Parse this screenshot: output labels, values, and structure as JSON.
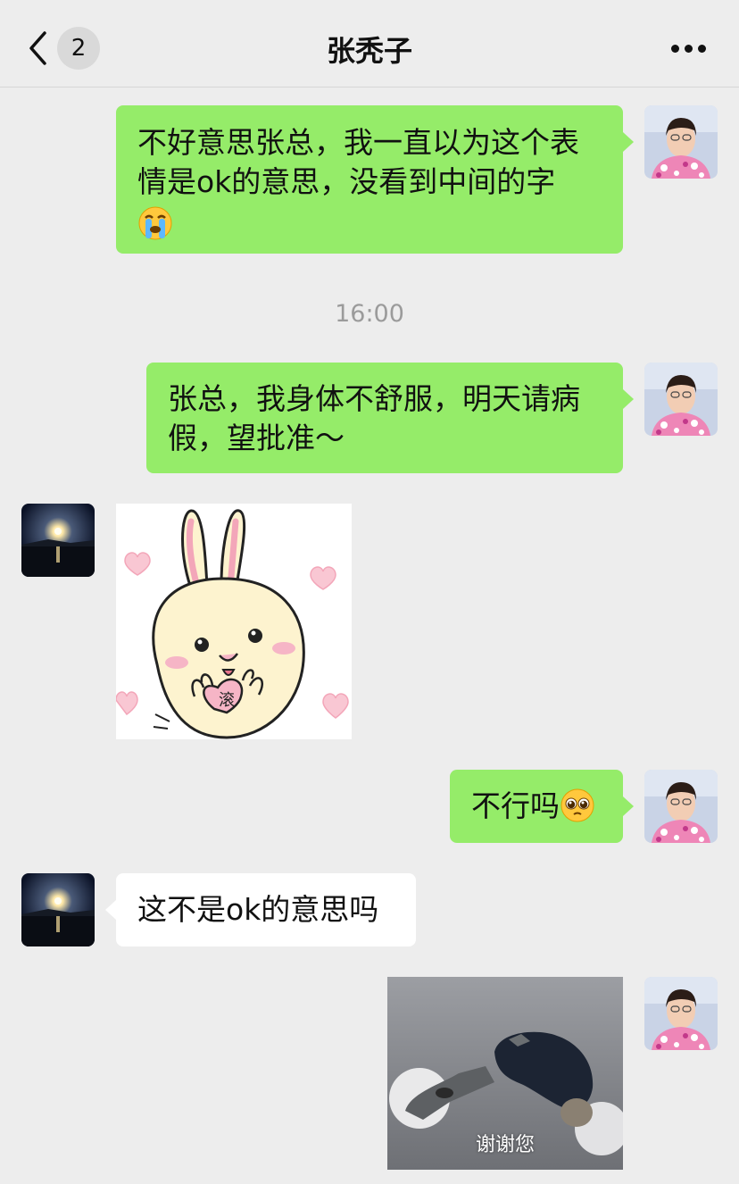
{
  "header": {
    "back_icon": "chevron-left-icon",
    "unread_count": "2",
    "title": "张秃子",
    "more_icon": "ellipsis-icon"
  },
  "messages": [
    {
      "side": "right",
      "type": "text",
      "lines": [
        "不好意思张总，我一直以为这个表",
        "情是ok的意思，没看到中间的字"
      ],
      "emoji": "crying-emoji-icon"
    },
    {
      "type": "timestamp",
      "text": "16:00"
    },
    {
      "side": "right",
      "type": "text",
      "lines": [
        "张总，我身体不舒服，明天请病",
        "假，望批准～"
      ]
    },
    {
      "side": "left",
      "type": "sticker",
      "sticker_text": "滚",
      "icon": "bunny-heart-sticker"
    },
    {
      "side": "right",
      "type": "text",
      "text": "不行吗",
      "emoji": "pleading-face-emoji-icon"
    },
    {
      "side": "left",
      "type": "text",
      "text": "这不是ok的意思吗"
    },
    {
      "side": "right",
      "type": "image",
      "caption": "谢谢您",
      "icon": "kowtow-meme-image"
    }
  ]
}
